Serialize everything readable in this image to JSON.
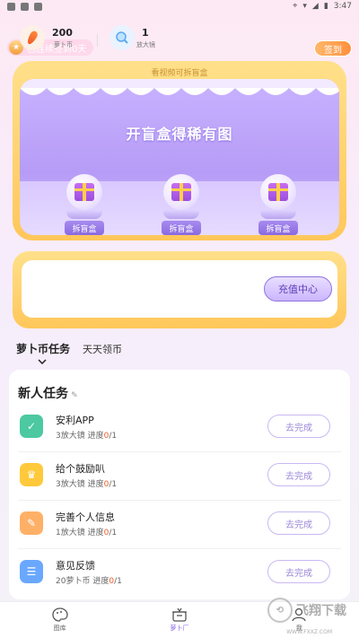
{
  "status": {
    "time": "3:47"
  },
  "streak": {
    "label": "已连续签到0天"
  },
  "checkin": {
    "label": "签到"
  },
  "blindbox": {
    "hint": "看视频可拆盲盒",
    "title": "开盲盒得稀有图",
    "boxes": [
      {
        "label": "拆盲盒"
      },
      {
        "label": "拆盲盒"
      },
      {
        "label": "拆盲盒"
      }
    ]
  },
  "wallet": {
    "coins_value": "200",
    "coins_label": "萝卜币",
    "magnifier_value": "1",
    "magnifier_label": "放大镜",
    "recharge_label": "充值中心"
  },
  "tabs": [
    {
      "label": "萝卜币任务"
    },
    {
      "label": "天天领币"
    }
  ],
  "tasks": {
    "title": "新人任务",
    "items": [
      {
        "title": "安利APP",
        "reward": "3放大镜",
        "progress_label": "进度",
        "current": "0",
        "total": "/1",
        "button": "去完成",
        "icon": "check-icon",
        "color": "#4cc9a0"
      },
      {
        "title": "给个鼓励叭",
        "reward": "3放大镜",
        "progress_label": "进度",
        "current": "0",
        "total": "/1",
        "button": "去完成",
        "icon": "trophy-icon",
        "color": "#ffc93c"
      },
      {
        "title": "完善个人信息",
        "reward": "1放大镜",
        "progress_label": "进度",
        "current": "0",
        "total": "/1",
        "button": "去完成",
        "icon": "edit-icon",
        "color": "#ffb067"
      },
      {
        "title": "意见反馈",
        "reward": "20萝卜币",
        "progress_label": "进度",
        "current": "0",
        "total": "/1",
        "button": "去完成",
        "icon": "clipboard-icon",
        "color": "#6aa8ff"
      }
    ]
  },
  "nav": [
    {
      "label": "图库"
    },
    {
      "label": "萝卜厂"
    },
    {
      "label": "我"
    }
  ],
  "watermark": {
    "title": "飞翔下载",
    "sub": "WWW.FXXZ.COM"
  },
  "colors": {
    "accent": "#8c6ae0",
    "gold": "#ffc75a",
    "orange": "#ff8f3d"
  }
}
